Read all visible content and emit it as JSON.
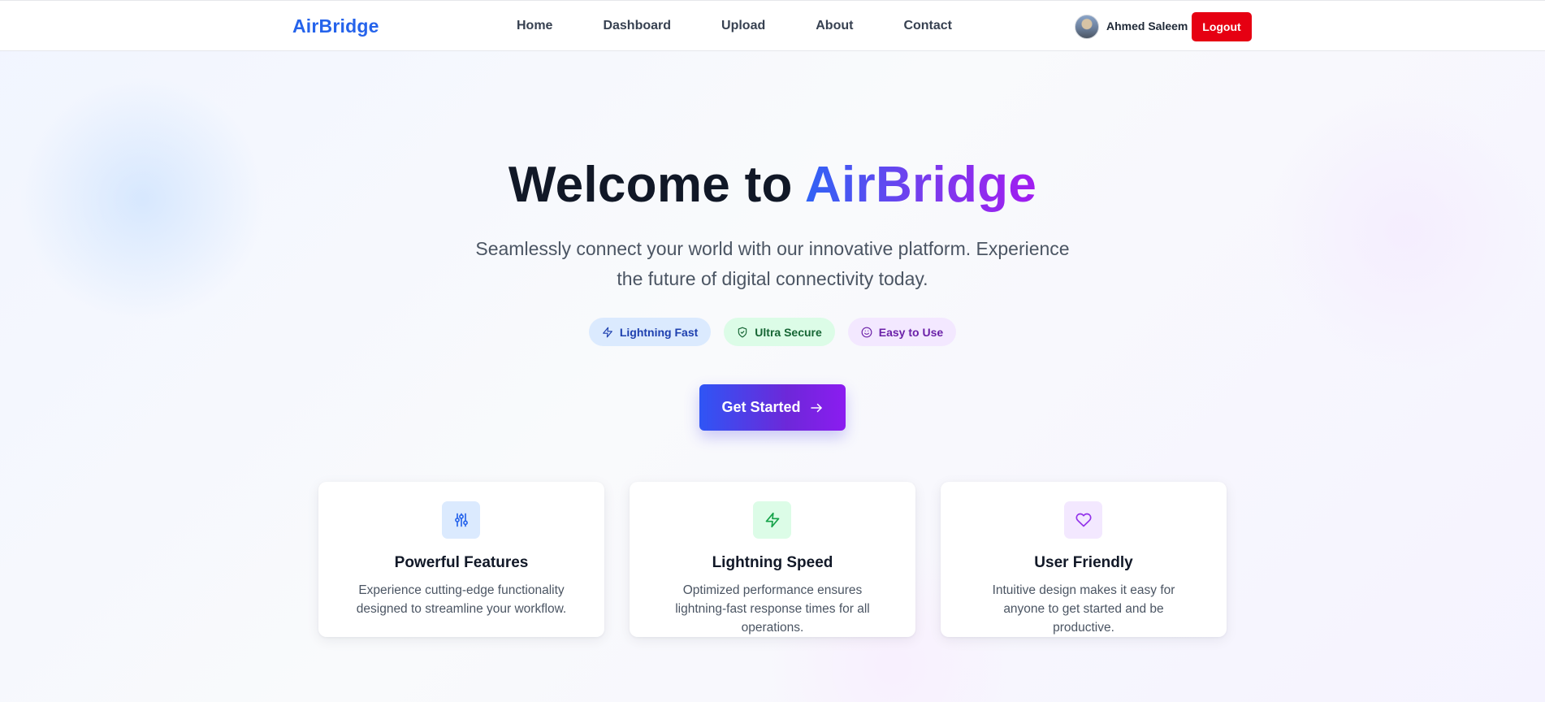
{
  "navbar": {
    "brand": "AirBridge",
    "links": [
      "Home",
      "Dashboard",
      "Upload",
      "About",
      "Contact"
    ],
    "user_name": "Ahmed Saleem",
    "logout_label": "Logout"
  },
  "hero": {
    "title_prefix": "Welcome to ",
    "title_accent": "AirBridge",
    "subtitle": "Seamlessly connect your world with our innovative platform. Experience the future of digital connectivity today.",
    "pills": [
      {
        "label": "Lightning Fast",
        "icon": "zap-icon"
      },
      {
        "label": "Ultra Secure",
        "icon": "shield-icon"
      },
      {
        "label": "Easy to Use",
        "icon": "smile-icon"
      }
    ],
    "cta_label": "Get Started"
  },
  "features": [
    {
      "title": "Powerful Features",
      "description": "Experience cutting-edge functionality designed to streamline your workflow.",
      "icon": "sliders-icon"
    },
    {
      "title": "Lightning Speed",
      "description": "Optimized performance ensures lightning-fast response times for all operations.",
      "icon": "zap-icon"
    },
    {
      "title": "User Friendly",
      "description": "Intuitive design makes it easy for anyone to get started and be productive.",
      "icon": "heart-icon"
    }
  ],
  "colors": {
    "brand": "#2563eb",
    "logout": "#e60012",
    "gradient_start": "#2f55f5",
    "gradient_end": "#8b1cf0"
  }
}
